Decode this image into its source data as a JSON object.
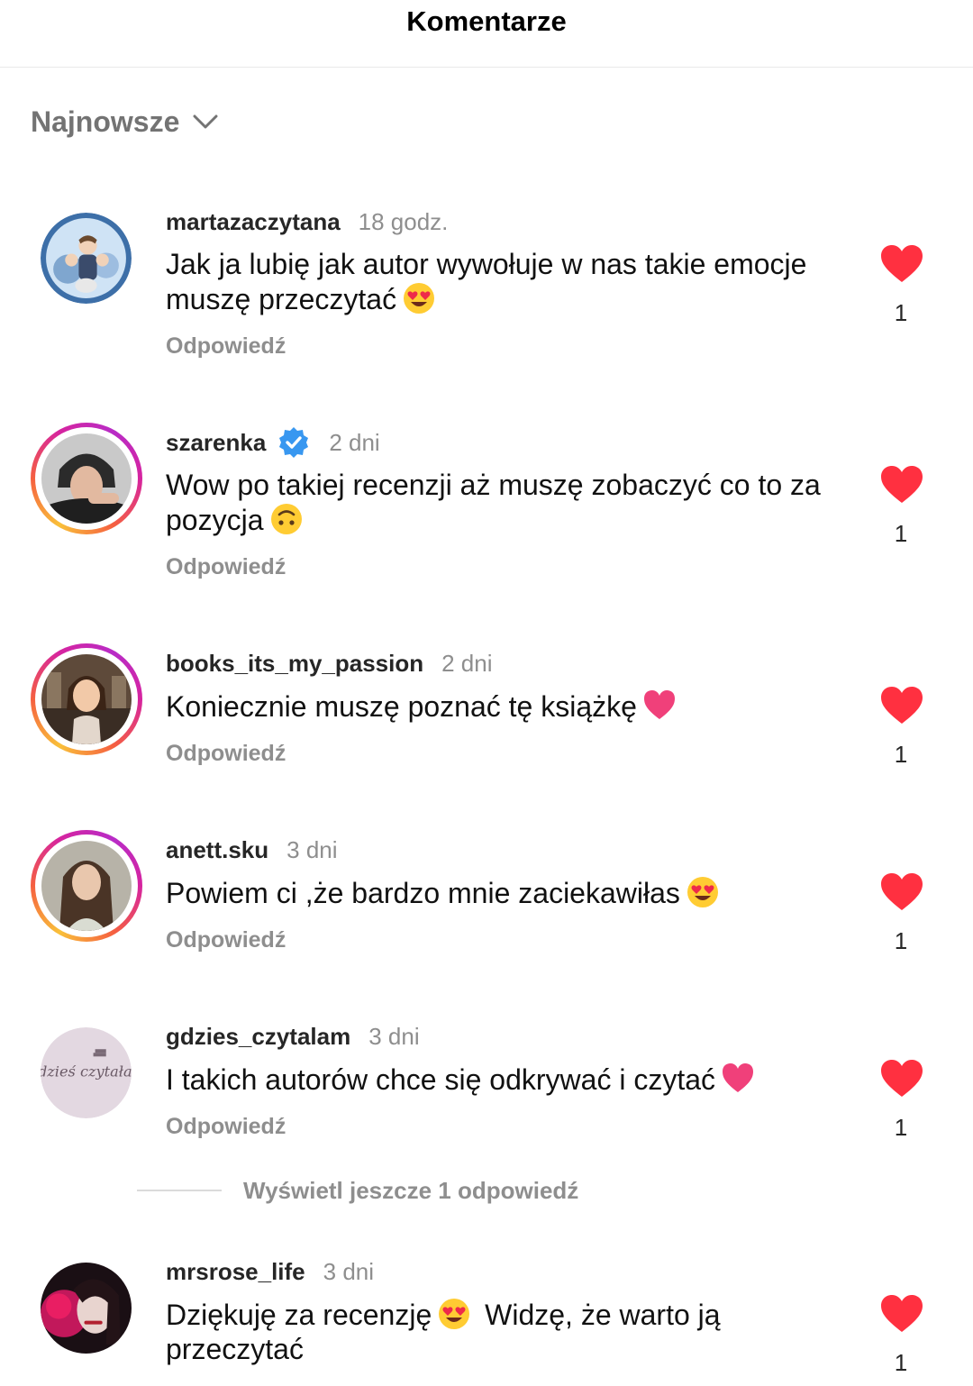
{
  "header": {
    "title": "Komentarze"
  },
  "sort": {
    "label": "Najnowsze",
    "icon": "chevron-down-icon"
  },
  "colors": {
    "like": "#ff3040",
    "verified": "#3897f0",
    "muted": "#8e8e8e"
  },
  "comments": [
    {
      "username": "martazaczytana",
      "time": "18 godz.",
      "verified": false,
      "text": "Jak ja lubię jak autor wywołuje w nas takie emocje muszę przeczytać",
      "emoji": "heart-eyes-emoji",
      "reply_label": "Odpowiedź",
      "likes": "1",
      "liked": true
    },
    {
      "username": "szarenka",
      "time": "2 dni",
      "verified": true,
      "text": "Wow po takiej recenzji aż muszę zobaczyć co to za pozycja",
      "emoji": "upside-down-face-emoji",
      "reply_label": "Odpowiedź",
      "likes": "1",
      "liked": true
    },
    {
      "username": "books_its_my_passion",
      "time": "2 dni",
      "verified": false,
      "text": "Koniecznie muszę poznać tę książkę",
      "emoji": "heart-emoji",
      "reply_label": "Odpowiedź",
      "likes": "1",
      "liked": true
    },
    {
      "username": "anett.sku",
      "time": "3 dni",
      "verified": false,
      "text": "Powiem ci ,że bardzo mnie zaciekawiłas",
      "emoji": "heart-eyes-emoji",
      "reply_label": "Odpowiedź",
      "likes": "1",
      "liked": true
    },
    {
      "username": "gdzies_czytalam",
      "time": "3 dni",
      "verified": false,
      "text": "I takich autorów chce się odkrywać i czytać",
      "emoji": "heart-emoji",
      "reply_label": "Odpowiedź",
      "likes": "1",
      "liked": true
    },
    {
      "username": "mrsrose_life",
      "time": "3 dni",
      "verified": false,
      "text_before": "Dziękuję za recenzję",
      "emoji": "heart-eyes-emoji",
      "text_after": "Widzę, że warto ją przeczytać",
      "likes": "1",
      "liked": true
    }
  ],
  "more_replies": {
    "label": "Wyświetl jeszcze 1 odpowiedź"
  },
  "avatar_logo_text": "Gdzieś czytałam"
}
